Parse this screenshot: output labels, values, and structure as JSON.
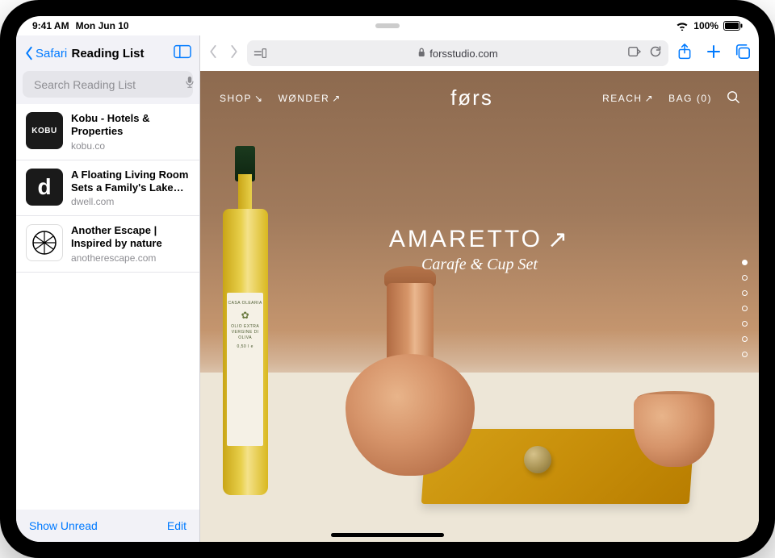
{
  "status": {
    "time": "9:41 AM",
    "date": "Mon Jun 10",
    "battery": "100%"
  },
  "sidebar": {
    "back": "Safari",
    "title": "Reading List",
    "search_placeholder": "Search Reading List",
    "items": [
      {
        "title": "Kobu - Hotels & Properties",
        "domain": "kobu.co",
        "thumb_label": "KOBU"
      },
      {
        "title": "A Floating Living Room Sets a Family's Lake M...",
        "domain": "dwell.com",
        "thumb_label": "d"
      },
      {
        "title": "Another Escape | Inspired by nature",
        "domain": "anotherescape.com",
        "thumb_label": ""
      }
    ],
    "footer_left": "Show Unread",
    "footer_right": "Edit"
  },
  "toolbar": {
    "url": "forsstudio.com"
  },
  "page": {
    "nav": {
      "shop": "SHOP",
      "wonder": "WØNDER",
      "logo": "førs",
      "reach": "REACH",
      "bag": "BAG (0)"
    },
    "hero": {
      "title": "AMARETTO",
      "subtitle": "Carafe & Cup Set"
    },
    "bottle_label": {
      "brand": "CASA OLEARIA",
      "text": "OLIO EXTRA VERGINE DI OLIVA",
      "size": "0,50 l e"
    }
  }
}
